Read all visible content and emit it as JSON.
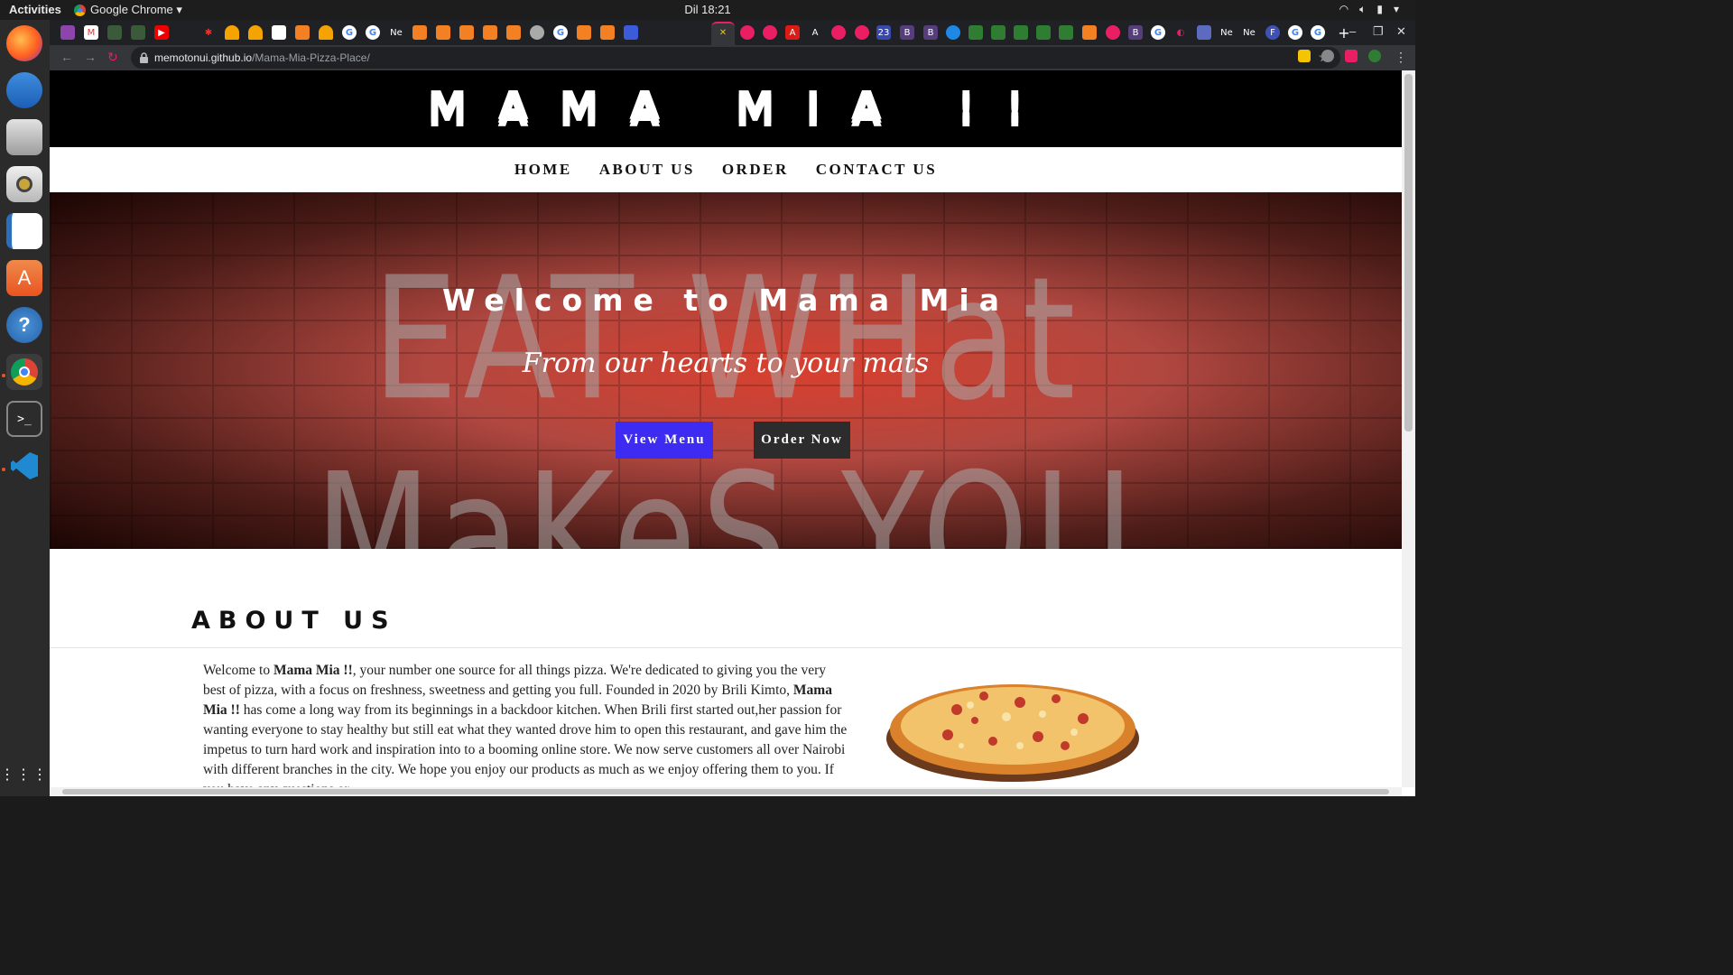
{
  "os": {
    "activities": "Activities",
    "app_menu": "Google Chrome ▾",
    "clock": "Dil 18:21"
  },
  "browser": {
    "url_host": "memotonui.github.io",
    "url_path": "/Mama-Mia-Pizza-Place/",
    "tab_labels": [
      "Ne",
      "Ne",
      "Ne",
      "23",
      "B",
      "B",
      "F",
      "A"
    ]
  },
  "site": {
    "logo": "MAMA MIA !!",
    "nav": {
      "home": "HOME",
      "about": "ABOUT US",
      "order": "ORDER",
      "contact": "CONTACT US"
    },
    "hero": {
      "title": "Welcome to Mama Mia",
      "tagline": "From our hearts to your mats",
      "neon_text": "EAT WHat MaKeS YOU HaPPY",
      "view_menu": "View Menu",
      "order_now": "Order Now"
    },
    "about": {
      "title": "ABOUT US",
      "p1": "Welcome to ",
      "brand1": "Mama Mia !!",
      "p2": ", your number one source for all things pizza. We're dedicated to giving you the very best of pizza, with a focus on freshness, sweetness and getting you full. Founded in 2020 by Brili Kimto, ",
      "brand2": "Mama Mia !!",
      "p3": " has come a long way from its beginnings in a backdoor kitchen. When Brili first started out,her passion for wanting everyone to stay healthy but still eat what they wanted drove him to open this restaurant, and gave him the impetus to turn hard work and inspiration into to a booming online store. We now serve customers all over Nairobi with different branches in the city. We hope you enjoy our products as much as we enjoy offering them to you. If you have any questions or"
    }
  },
  "colors": {
    "view_menu_bg": "#3e2bf2",
    "order_now_bg": "#2c2c2c",
    "active_tab_accent": "#e91e63"
  }
}
